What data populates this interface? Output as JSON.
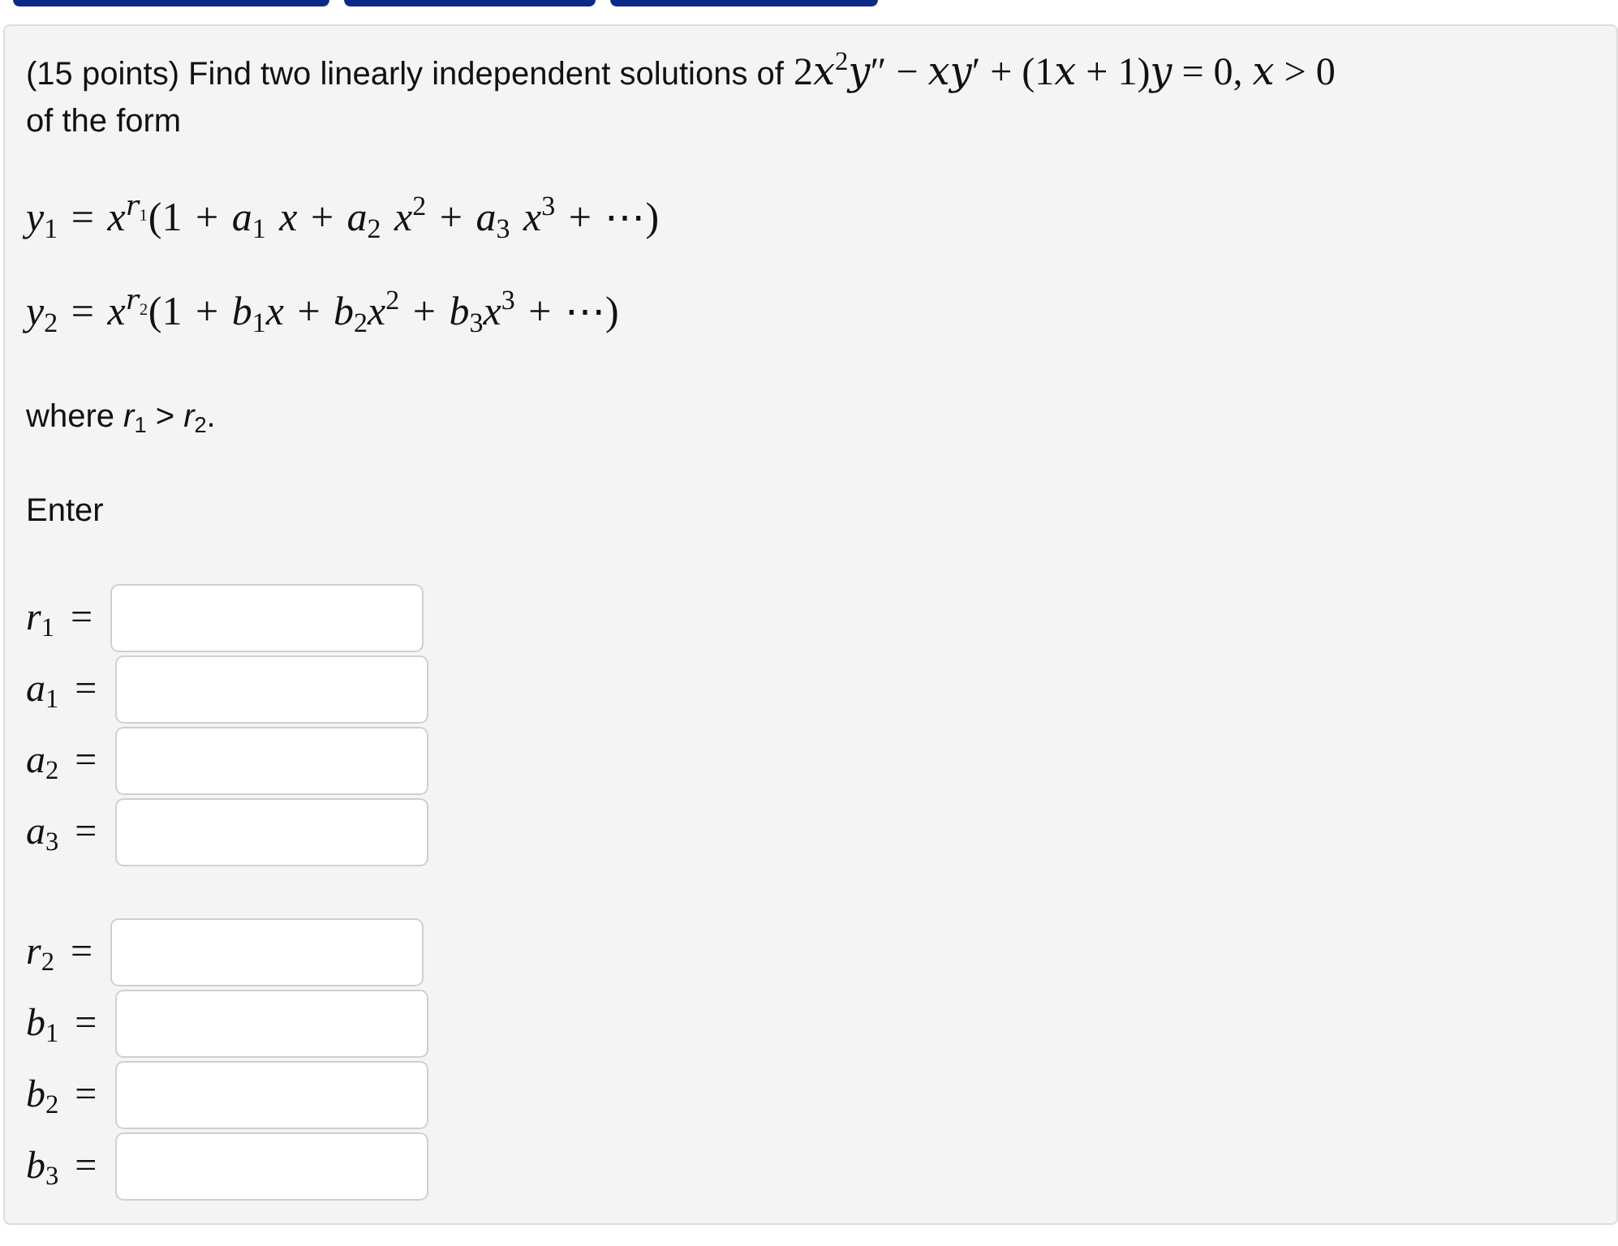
{
  "question": {
    "prompt": "(15 points) Find two linearly independent solutions of",
    "equation": "2𝑥$^{2}$𝑦″ − 𝑥𝑦′ + (1𝑥 + 1)𝑦 = 0, 𝑥 > 0",
    "prompt_end": "of the form",
    "solutions": [
      "*y*$_{1}$ = *x*$^{𝑟₁}$(1 + *a*$_{1}$ *x* + *a*$_{2}$ *x*$^{2}$ + *a*$_{3}$ *x*$^{3}$ + ⋯)",
      "*y*$_{2}$ = *x*$^{𝑟₂}$(1 + *b*$_{1}$*x* + *b*$_{2}$*x*$^{2}$ + *b*$_{3}$*x*$^{3}$ + ⋯)"
    ],
    "condition": "where *r*$_{1}$ > *r*$_{2}$.",
    "instruction": "Enter"
  },
  "answer_groups": [
    {
      "fields": [
        {
          "label": "*r*$_{1}$ ="
        },
        {
          "label": "*a*$_{1}$ ="
        },
        {
          "label": "*a*$_{2}$ ="
        },
        {
          "label": "*a*$_{3}$ ="
        }
      ]
    },
    {
      "fields": [
        {
          "label": "*r*$_{2}$ ="
        },
        {
          "label": "*b*$_{1}$ ="
        },
        {
          "label": "*b*$_{2}$ ="
        },
        {
          "label": "*b*$_{3}$ ="
        }
      ]
    }
  ]
}
